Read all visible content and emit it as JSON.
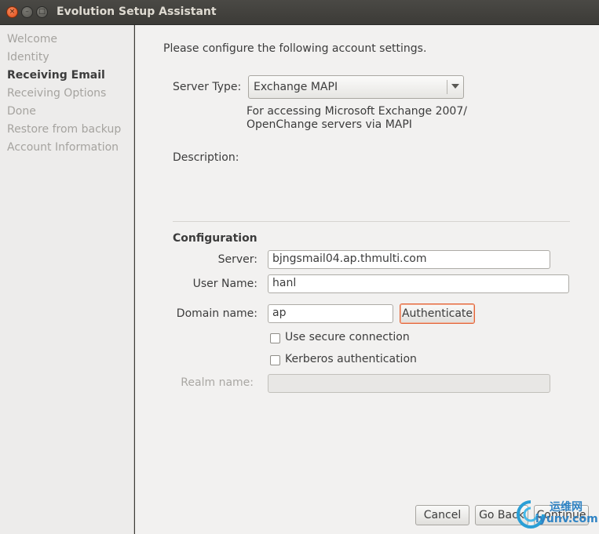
{
  "window": {
    "title": "Evolution Setup Assistant"
  },
  "window_controls": {
    "close": "×",
    "minimize": "–",
    "maximize": "□"
  },
  "sidebar": {
    "items": [
      {
        "label": "Welcome",
        "active": false
      },
      {
        "label": "Identity",
        "active": false
      },
      {
        "label": "Receiving Email",
        "active": true
      },
      {
        "label": "Receiving Options",
        "active": false
      },
      {
        "label": "Done",
        "active": false
      },
      {
        "label": "Restore from backup",
        "active": false
      },
      {
        "label": "Account Information",
        "active": false
      }
    ]
  },
  "main": {
    "intro": "Please configure the following account settings.",
    "server_type": {
      "label": "Server Type:",
      "value": "Exchange MAPI",
      "help_line1": "For accessing Microsoft Exchange 2007/",
      "help_line2": "OpenChange servers via MAPI"
    },
    "description_label": "Description:",
    "configuration": {
      "heading": "Configuration",
      "server_label": "Server:",
      "server_value": "bjngsmail04.ap.thmulti.com",
      "username_label": "User Name:",
      "username_value": "hanl",
      "domain_label": "Domain name:",
      "domain_value": "ap",
      "authenticate_label": "Authenticate",
      "secure_label": "Use secure connection",
      "kerberos_label": "Kerberos authentication",
      "realm_label": "Realm name:",
      "realm_value": ""
    },
    "buttons": {
      "cancel": "Cancel",
      "go_back": "Go Back",
      "continue": "Continue"
    }
  },
  "watermark": {
    "line1": "运维网",
    "line2": "iyunv.com"
  }
}
